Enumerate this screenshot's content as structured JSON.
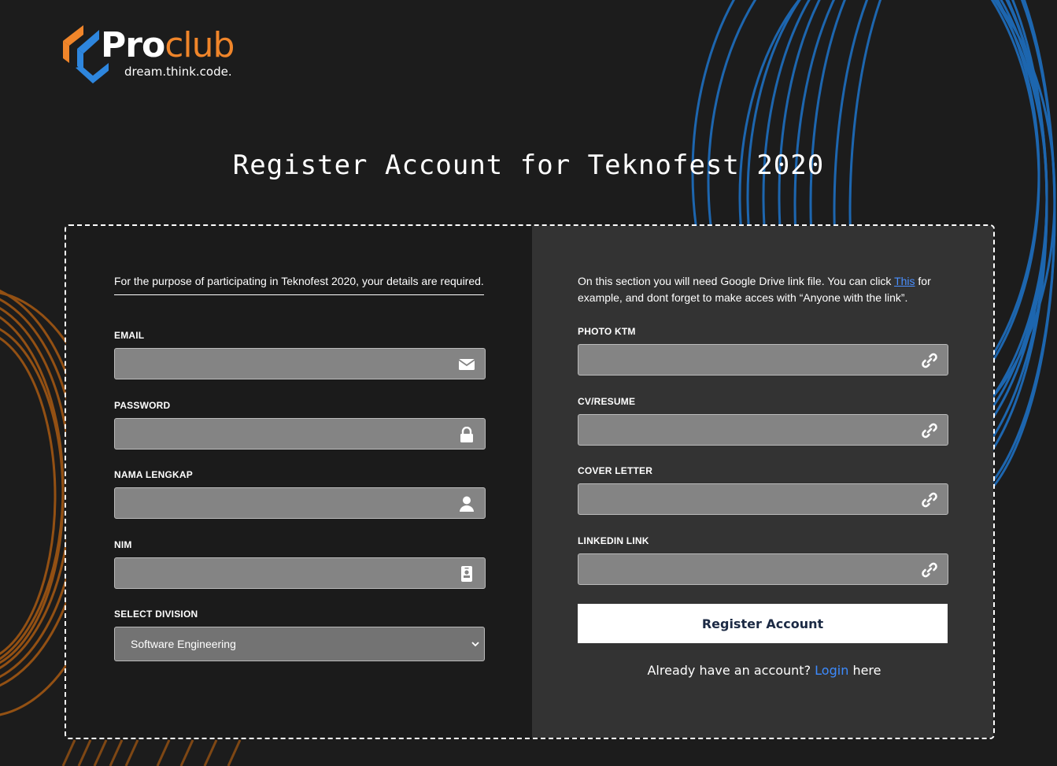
{
  "brand": {
    "name_part1": "Pro",
    "name_part2": "club",
    "tagline": "dream.think.code."
  },
  "page_title": "Register Account for Teknofest 2020",
  "left_section": {
    "intro": "For the purpose of participating in Teknofest 2020, your details are required.",
    "fields": [
      {
        "label": "EMAIL",
        "value": "",
        "icon": "envelope-icon"
      },
      {
        "label": "PASSWORD",
        "value": "",
        "icon": "lock-icon"
      },
      {
        "label": "NAMA LENGKAP",
        "value": "",
        "icon": "user-icon"
      },
      {
        "label": "NIM",
        "value": "",
        "icon": "id-badge-icon"
      }
    ],
    "division": {
      "label": "SELECT DIVISION",
      "selected": "Software Engineering"
    }
  },
  "right_section": {
    "intro_before": "On this section you will need Google Drive link file. You can click ",
    "intro_link": "This",
    "intro_after": " for example, and dont forget to make acces with “Anyone with the link”.",
    "fields": [
      {
        "label": "PHOTO KTM",
        "value": "",
        "icon": "link-icon"
      },
      {
        "label": "CV/RESUME",
        "value": "",
        "icon": "link-icon"
      },
      {
        "label": "COVER LETTER",
        "value": "",
        "icon": "link-icon"
      },
      {
        "label": "LINKEDIN LINK",
        "value": "",
        "icon": "link-icon"
      }
    ],
    "register_button": "Register Account",
    "login_prefix": "Already have an account?",
    "login_link": "Login",
    "login_suffix": "here"
  },
  "colors": {
    "background": "#1c1c1c",
    "panel_right": "#333333",
    "field_bg": "#848484",
    "brand_orange": "#f0852a",
    "brand_blue": "#2e86de",
    "link_blue": "#3d8bff"
  }
}
